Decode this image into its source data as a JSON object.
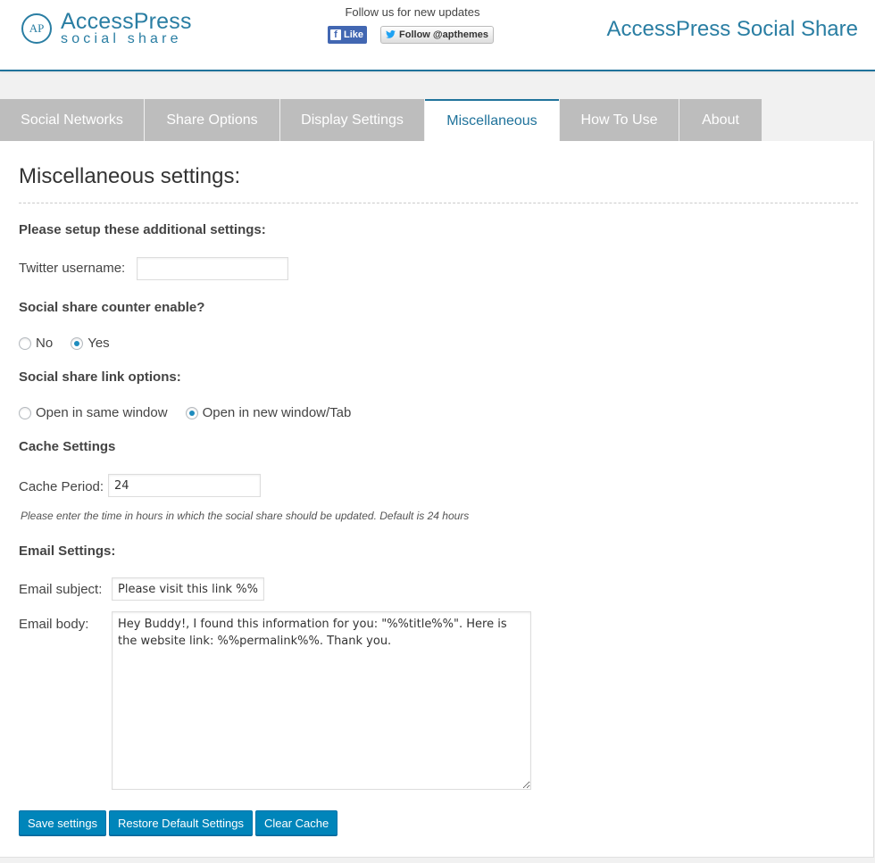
{
  "header": {
    "logo_mark": "AP",
    "logo_main": "AccessPress",
    "logo_sub": "social share",
    "follow_text": "Follow us for new updates",
    "fb_like_label": "Like",
    "twitter_follow_label": "Follow @apthemes",
    "plugin_title": "AccessPress Social Share"
  },
  "tabs": [
    {
      "label": "Social Networks",
      "active": false
    },
    {
      "label": "Share Options",
      "active": false
    },
    {
      "label": "Display Settings",
      "active": false
    },
    {
      "label": "Miscellaneous",
      "active": true
    },
    {
      "label": "How To Use",
      "active": false
    },
    {
      "label": "About",
      "active": false
    }
  ],
  "misc": {
    "title": "Miscellaneous settings:",
    "intro": "Please setup these additional settings:",
    "twitter_label": "Twitter username:",
    "twitter_value": "",
    "counter_title": "Social share counter enable?",
    "counter_no": "No",
    "counter_yes": "Yes",
    "counter_selected": "Yes",
    "link_title": "Social share link options:",
    "link_same": "Open in same window",
    "link_new": "Open in new window/Tab",
    "link_selected": "Open in new window/Tab",
    "cache_title": "Cache Settings",
    "cache_label": "Cache Period:",
    "cache_value": "24",
    "cache_note": "Please enter the time in hours in which the social share should be updated. Default is 24 hours",
    "email_title": "Email Settings:",
    "email_subject_label": "Email subject:",
    "email_subject_value": "Please visit this link %%url%%",
    "email_body_label": "Email body:",
    "email_body_value": "Hey Buddy!, I found this information for you: \"%%title%%\". Here is the website link: %%permalink%%. Thank you."
  },
  "buttons": {
    "save": "Save settings",
    "restore": "Restore Default Settings",
    "clear": "Clear Cache"
  },
  "colors": {
    "accent": "#20739b",
    "button": "#0085ba",
    "tab_inactive": "#bdbdbd"
  }
}
